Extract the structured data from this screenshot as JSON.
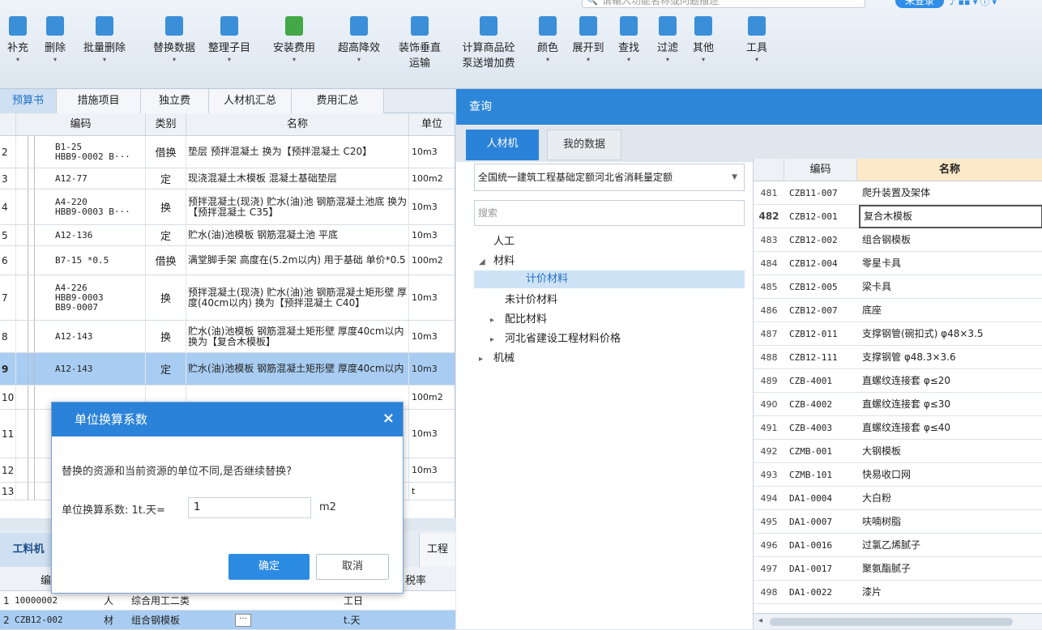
{
  "header": {
    "search_placeholder": "请输入功能名称或问题描述",
    "login_label": "未登录"
  },
  "toolbar": [
    {
      "label": "补充",
      "icon": "add-doc-icon",
      "color": "#3b8fd8"
    },
    {
      "label": "删除",
      "icon": "trash-icon",
      "color": "#3b8fd8"
    },
    {
      "label": "批量删除",
      "icon": "batch-delete-icon",
      "color": "#3b8fd8"
    },
    {
      "label": "替换数据",
      "icon": "replace-icon",
      "color": "#3b8fd8"
    },
    {
      "label": "整理子目",
      "icon": "organize-icon",
      "color": "#3b8fd8"
    },
    {
      "label": "安装费用",
      "icon": "install-cost-icon",
      "color": "#44a848"
    },
    {
      "label": "超高降效",
      "icon": "height-icon",
      "color": "#3b8fd8"
    },
    {
      "label": "装饰垂直",
      "label2": "运输",
      "icon": "elevator-icon",
      "color": "#3b8fd8"
    },
    {
      "label": "计算商品砼",
      "label2": "泵送增加费",
      "icon": "pump-icon",
      "color": "#3b8fd8"
    },
    {
      "label": "颜色",
      "icon": "color-icon",
      "color": "#3b8fd8"
    },
    {
      "label": "展开到",
      "icon": "expand-icon",
      "color": "#3b8fd8"
    },
    {
      "label": "查找",
      "icon": "binoculars-icon",
      "color": "#3b8fd8"
    },
    {
      "label": "过滤",
      "icon": "filter-icon",
      "color": "#3b8fd8"
    },
    {
      "label": "其他",
      "icon": "grid-icon",
      "color": "#3b8fd8"
    },
    {
      "label": "工具",
      "icon": "tool-icon",
      "color": "#3b8fd8"
    }
  ],
  "left_tabs": [
    "预算书",
    "措施项目",
    "独立费",
    "人材机汇总",
    "费用汇总"
  ],
  "main_grid": {
    "headers": [
      "编码",
      "类别",
      "名称",
      "单位"
    ],
    "rows": [
      {
        "num": "2",
        "code": "B1-25\nHBB9-0002 B···",
        "type": "借换",
        "name": "垫层 预拌混凝土 换为【预拌混凝土 C20】",
        "unit": "10m3"
      },
      {
        "num": "3",
        "code": "A12-77",
        "type": "定",
        "name": "现浇混凝土木模板 混凝土基础垫层",
        "unit": "100m2"
      },
      {
        "num": "4",
        "code": "A4-220\nHBB9-0003 B···",
        "type": "换",
        "name": "预拌混凝土(现浇) 贮水(油)池 钢筋混凝土池底 换为【预拌混凝土 C35】",
        "unit": "10m3"
      },
      {
        "num": "5",
        "code": "A12-136",
        "type": "定",
        "name": "贮水(油)池模板 钢筋混凝土池 平底",
        "unit": "10m3"
      },
      {
        "num": "6",
        "code": "B7-15 *0.5",
        "type": "借换",
        "name": "满堂脚手架 高度在(5.2m以内) 用于基础 单价*0.5",
        "unit": "100m2"
      },
      {
        "num": "7",
        "code": "A4-226\nHBB9-0003\nBB9-0007",
        "type": "换",
        "name": "预拌混凝土(现浇) 贮水(油)池 钢筋混凝土矩形壁 厚度(40cm以内) 换为【预拌混凝土 C40】",
        "unit": "10m3"
      },
      {
        "num": "8",
        "code": "A12-143",
        "type": "换",
        "name": "贮水(油)池模板 钢筋混凝土矩形壁 厚度40cm以内 换为【复合木模板】",
        "unit": "10m3"
      },
      {
        "num": "9",
        "code": "A12-143",
        "type": "定",
        "name": "贮水(油)池模板 钢筋混凝土矩形壁 厚度40cm以内",
        "unit": "10m3"
      },
      {
        "num": "10",
        "code": "",
        "type": "",
        "name": "",
        "unit": "100m2"
      },
      {
        "num": "11",
        "code": "",
        "type": "",
        "name": "",
        "unit": "10m3"
      },
      {
        "num": "12",
        "code": "",
        "type": "",
        "name": "",
        "unit": "10m3"
      },
      {
        "num": "13",
        "code": "",
        "type": "",
        "name": "",
        "unit": "t"
      }
    ]
  },
  "bottom": {
    "tab_main": "工料机",
    "tab_right": "工程",
    "col_code": "编",
    "col_rate": "税率",
    "rows": [
      {
        "num": "1",
        "code": "10000002",
        "type": "人",
        "name": "综合用工二类",
        "unit": "工日"
      },
      {
        "num": "2",
        "code": "CZB12-002",
        "type": "材",
        "name": "组合钢模板",
        "unit": "t.天"
      }
    ]
  },
  "dialog": {
    "title": "单位换算系数",
    "close": "×",
    "message": "替换的资源和当前资源的单位不同,是否继续替换?",
    "factor_label": "单位换算系数: 1t.天=",
    "factor_value": "1",
    "unit": "m2",
    "ok": "确定",
    "cancel": "取消"
  },
  "query": {
    "title": "查询",
    "tabs": [
      "人材机",
      "我的数据"
    ],
    "library": "全国统一建筑工程基础定额河北省消耗量定额",
    "search_placeholder": "搜索",
    "tree": [
      {
        "label": "人工",
        "level": 0,
        "arrow": ""
      },
      {
        "label": "材料",
        "level": 0,
        "arrow": "◢"
      },
      {
        "label": "计价材料",
        "level": 1,
        "arrow": "",
        "selected": true
      },
      {
        "label": "未计价材料",
        "level": 1,
        "arrow": ""
      },
      {
        "label": "配比材料",
        "level": 1,
        "arrow": "▸"
      },
      {
        "label": "河北省建设工程材料价格",
        "level": 1,
        "arrow": "▸"
      },
      {
        "label": "机械",
        "level": 0,
        "arrow": "▸"
      }
    ],
    "grid_headers": [
      "编码",
      "名称"
    ],
    "grid_rows": [
      {
        "n": "481",
        "code": "CZB11-007",
        "name": "爬升装置及架体"
      },
      {
        "n": "482",
        "code": "CZB12-001",
        "name": "复合木模板"
      },
      {
        "n": "483",
        "code": "CZB12-002",
        "name": "组合钢模板"
      },
      {
        "n": "484",
        "code": "CZB12-004",
        "name": "零星卡具"
      },
      {
        "n": "485",
        "code": "CZB12-005",
        "name": "梁卡具"
      },
      {
        "n": "486",
        "code": "CZB12-007",
        "name": "底座"
      },
      {
        "n": "487",
        "code": "CZB12-011",
        "name": "支撑钢管(碗扣式) φ48×3.5"
      },
      {
        "n": "488",
        "code": "CZB12-111",
        "name": "支撑钢管 φ48.3×3.6"
      },
      {
        "n": "489",
        "code": "CZB-4001",
        "name": "直螺纹连接套 φ≤20"
      },
      {
        "n": "490",
        "code": "CZB-4002",
        "name": "直螺纹连接套 φ≤30"
      },
      {
        "n": "491",
        "code": "CZB-4003",
        "name": "直螺纹连接套 φ≤40"
      },
      {
        "n": "492",
        "code": "CZMB-001",
        "name": "大钢模板"
      },
      {
        "n": "493",
        "code": "CZMB-101",
        "name": "快易收口网"
      },
      {
        "n": "494",
        "code": "DA1-0004",
        "name": "大白粉"
      },
      {
        "n": "495",
        "code": "DA1-0007",
        "name": "呋喃树脂"
      },
      {
        "n": "496",
        "code": "DA1-0016",
        "name": "过氯乙烯腻子"
      },
      {
        "n": "497",
        "code": "DA1-0017",
        "name": "聚氨酯腻子"
      },
      {
        "n": "498",
        "code": "DA1-0022",
        "name": "漆片"
      }
    ]
  }
}
